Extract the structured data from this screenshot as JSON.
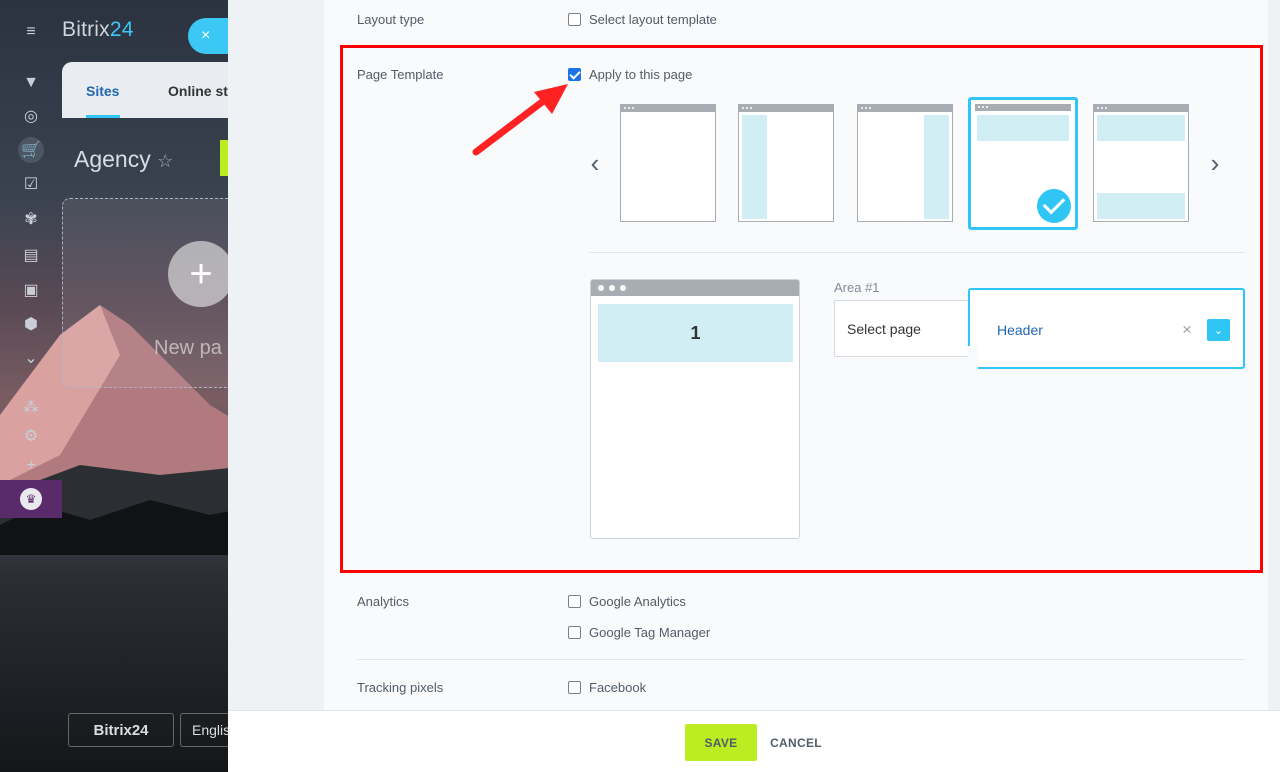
{
  "background": {
    "brand_main": "Bitrix",
    "brand_num": "24",
    "close_glyph": "×",
    "tabs": {
      "sites": "Sites",
      "online_store": "Online st"
    },
    "agency_title": "Agency",
    "star_glyph": "☆",
    "plus_glyph": "+",
    "new_page_label": "New pa",
    "footer_brand": "Bitrix24",
    "footer_lang": "Englis"
  },
  "form": {
    "layout_type": {
      "label": "Layout type",
      "checkbox_label": "Select layout template",
      "checked": false
    },
    "page_template": {
      "label": "Page Template",
      "checkbox_label": "Apply to this page",
      "checked": true,
      "prev_glyph": "‹",
      "next_glyph": "›",
      "templates": [
        {
          "name": "empty"
        },
        {
          "name": "left-sidebar"
        },
        {
          "name": "right-sidebar"
        },
        {
          "name": "header",
          "selected": true
        },
        {
          "name": "header-footer"
        }
      ],
      "preview_area_number": "1",
      "area_label": "Area #1",
      "select_page_label": "Select page",
      "selected_area_value": "Header",
      "clear_glyph": "×",
      "dropdown_glyph": "⌄"
    },
    "analytics": {
      "label": "Analytics",
      "google_analytics": "Google Analytics",
      "google_tag_manager": "Google Tag Manager"
    },
    "tracking_pixels": {
      "label": "Tracking pixels",
      "facebook": "Facebook"
    }
  },
  "actions": {
    "save": "SAVE",
    "cancel": "CANCEL"
  },
  "colors": {
    "accent_blue": "#2fc6f6",
    "save_green": "#bbed21",
    "highlight_red": "#ff0000",
    "zone_fill": "#d2eef5",
    "link_blue": "#2067b0"
  },
  "icons": {
    "rail": [
      "menu-icon",
      "filter-icon",
      "target-icon",
      "cart-icon",
      "task-icon",
      "crm-icon",
      "contact-card-icon",
      "robot-icon",
      "box-icon",
      "chevron-circle-icon",
      "network-icon",
      "gear-icon",
      "plus-icon",
      "crown-icon"
    ]
  }
}
